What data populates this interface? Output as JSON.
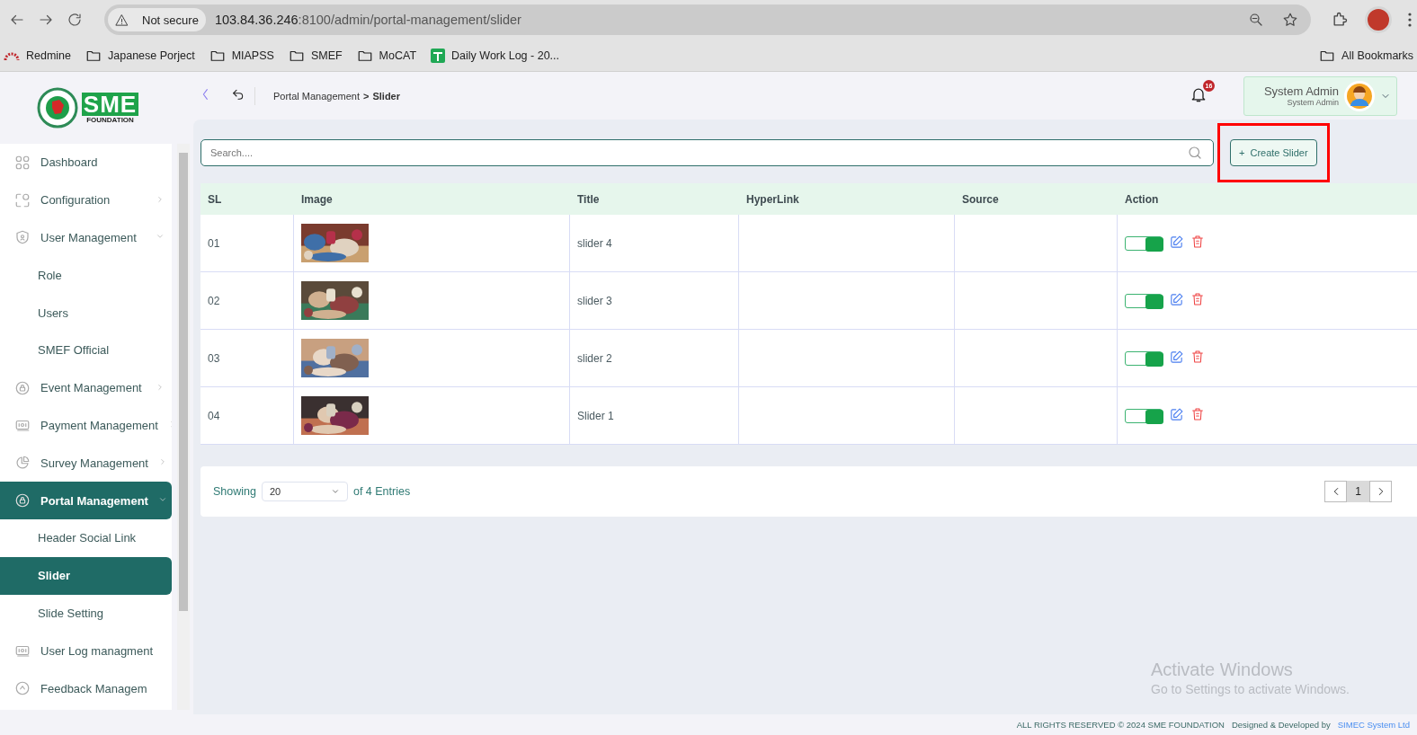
{
  "browser": {
    "security": "Not secure",
    "url_host": "103.84.36.246",
    "url_path": ":8100/admin/portal-management/slider",
    "bookmarks": [
      {
        "label": "Redmine",
        "kind": "site"
      },
      {
        "label": "Japanese Porject",
        "kind": "folder"
      },
      {
        "label": "MIAPSS",
        "kind": "folder"
      },
      {
        "label": "SMEF",
        "kind": "folder"
      },
      {
        "label": "MoCAT",
        "kind": "folder"
      },
      {
        "label": "Daily Work Log - 20...",
        "kind": "sheet"
      }
    ],
    "all_bookmarks": "All Bookmarks"
  },
  "logo": {
    "brand": "SME",
    "subtitle": "FOUNDATION"
  },
  "sidebar": {
    "items": [
      {
        "label": "Dashboard",
        "selected": false
      },
      {
        "label": "Configuration",
        "selected": false,
        "expanded": false
      },
      {
        "label": "User Management",
        "selected": false,
        "expanded": true,
        "children": [
          {
            "label": "Role",
            "selected": false
          },
          {
            "label": "Users",
            "selected": false
          },
          {
            "label": "SMEF Official",
            "selected": false
          }
        ]
      },
      {
        "label": "Event Management",
        "selected": false,
        "expanded": false
      },
      {
        "label": "Payment Management",
        "selected": false,
        "expanded": false
      },
      {
        "label": "Survey Management",
        "selected": false,
        "expanded": false
      },
      {
        "label": "Portal Management",
        "selected": true,
        "expanded": true,
        "children": [
          {
            "label": "Header Social Link",
            "selected": false
          },
          {
            "label": "Slider",
            "selected": true
          },
          {
            "label": "Slide Setting",
            "selected": false
          }
        ]
      },
      {
        "label": "User Log managment",
        "selected": false
      },
      {
        "label": "Feedback Managem",
        "selected": false
      }
    ]
  },
  "breadcrumb": {
    "parent": "Portal Management",
    "separator": ">",
    "current": "Slider"
  },
  "notifications": {
    "count": "16"
  },
  "user": {
    "name": "System Admin",
    "role": "System Admin"
  },
  "search": {
    "placeholder": "Search...."
  },
  "create_button": {
    "label": "Create Slider",
    "icon": "+",
    "highlighted": true
  },
  "table": {
    "columns": [
      "SL",
      "Image",
      "Title",
      "HyperLink",
      "Source",
      "Action"
    ],
    "rows": [
      {
        "sl": "01",
        "title": "slider 4",
        "active": true
      },
      {
        "sl": "02",
        "title": "slider 3",
        "active": true
      },
      {
        "sl": "03",
        "title": "slider 2",
        "active": true
      },
      {
        "sl": "04",
        "title": "Slider 1",
        "active": true
      }
    ]
  },
  "pagination": {
    "showing": "Showing",
    "page_size": "20",
    "entries": "of 4 Entries",
    "pages": [
      {
        "label": "1",
        "selected": true
      }
    ]
  },
  "os_notice": {
    "title": "Activate Windows",
    "subtitle": "Go to Settings to activate Windows."
  },
  "footer": {
    "rights": "ALL RIGHTS RESERVED © 2024 SME FOUNDATION",
    "designed": "Designed & Developed by",
    "company": "SIMEC System Ltd"
  }
}
